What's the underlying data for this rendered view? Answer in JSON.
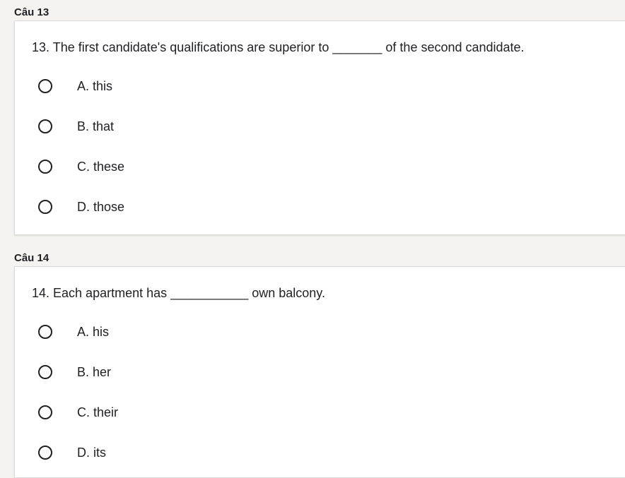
{
  "questions": [
    {
      "section_label": "Câu 13",
      "text": "13. The first candidate's qualifications are superior to _______ of the second candidate.",
      "options": [
        "A. this",
        "B. that",
        "C. these",
        "D. those"
      ]
    },
    {
      "section_label": "Câu 14",
      "text": "14. Each apartment has ___________ own balcony.",
      "options": [
        "A. his",
        "B. her",
        "C. their",
        "D. its"
      ]
    }
  ]
}
